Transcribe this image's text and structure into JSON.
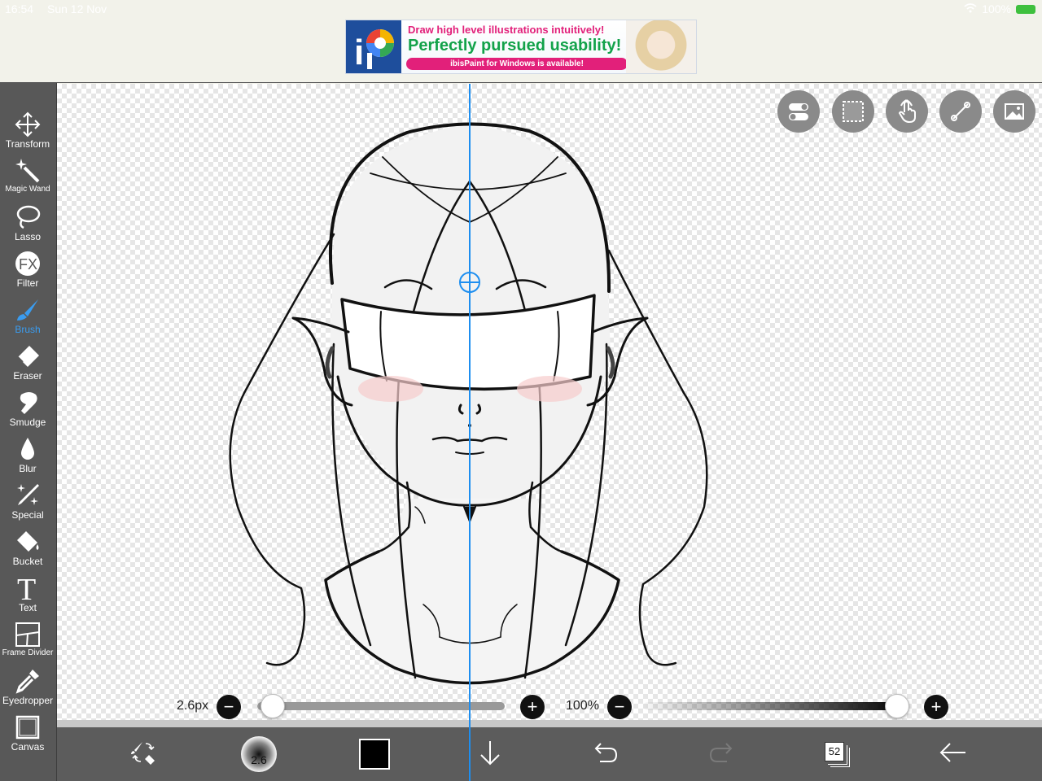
{
  "status": {
    "time": "16:54",
    "date": "Sun 12 Nov",
    "battery": "100%"
  },
  "ad": {
    "line1": "Draw high level illustrations intuitively!",
    "line2": "Perfectly pursued usability!",
    "line3": "ibisPaint for Windows is available!"
  },
  "tools": [
    {
      "label": "Transform",
      "icon": "move-arrows-icon"
    },
    {
      "label": "Magic Wand",
      "icon": "magic-wand-icon"
    },
    {
      "label": "Lasso",
      "icon": "lasso-icon"
    },
    {
      "label": "Filter",
      "icon": "fx-icon"
    },
    {
      "label": "Brush",
      "icon": "brush-icon"
    },
    {
      "label": "Eraser",
      "icon": "eraser-icon"
    },
    {
      "label": "Smudge",
      "icon": "smudge-icon"
    },
    {
      "label": "Blur",
      "icon": "blur-drop-icon"
    },
    {
      "label": "Special",
      "icon": "sparkle-pen-icon"
    },
    {
      "label": "Bucket",
      "icon": "bucket-icon"
    },
    {
      "label": "Text",
      "icon": "text-t-icon"
    },
    {
      "label": "Frame Divider",
      "icon": "frame-divider-icon"
    },
    {
      "label": "Eyedropper",
      "icon": "eyedropper-icon"
    },
    {
      "label": "Canvas",
      "icon": "canvas-square-icon"
    }
  ],
  "active_tool": "Brush",
  "brush": {
    "size_label": "2.6px",
    "preview_value": "2.6",
    "size_level": 0.02
  },
  "opacity": {
    "label": "100%",
    "level": 1.0
  },
  "color": {
    "current": "#000000",
    "accent": "#1d8ef0"
  },
  "layers": {
    "count": "52"
  },
  "top_controls": [
    "toggle-icon",
    "selection-icon",
    "hand-touch-icon",
    "ruler-icon",
    "reference-image-icon"
  ]
}
